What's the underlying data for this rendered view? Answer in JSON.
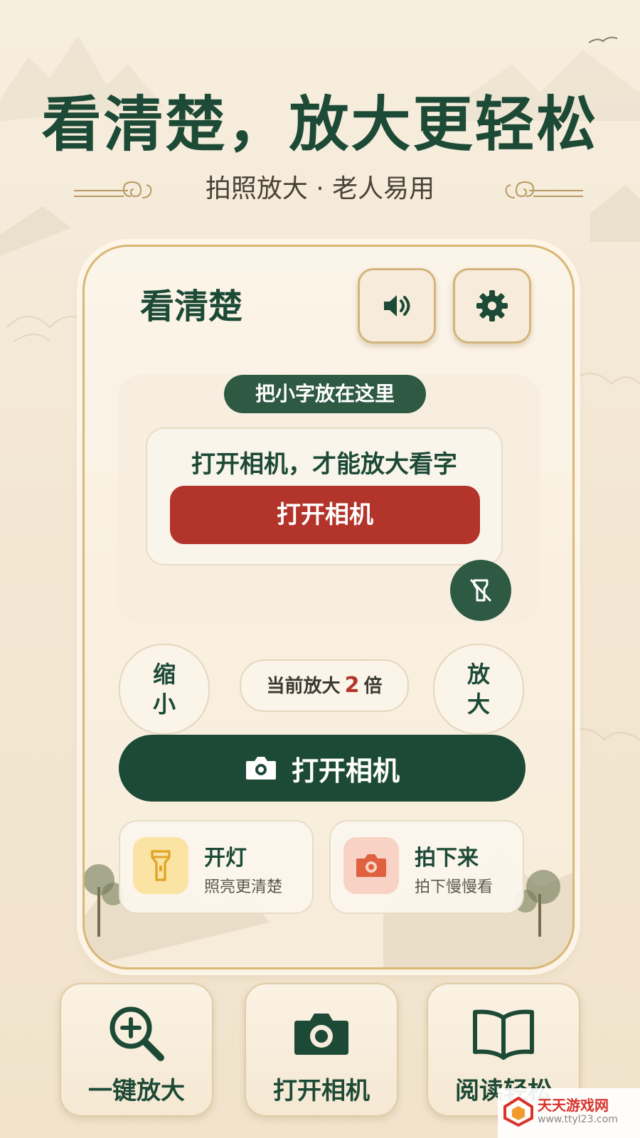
{
  "hero": {
    "title": "看清楚，放大更轻松",
    "subtitle": "拍照放大 · 老人易用"
  },
  "card": {
    "title": "看清楚",
    "sound_icon": "volume-icon",
    "settings_icon": "gear-icon",
    "preview": {
      "hint": "把小字放在这里",
      "message": "打开相机，才能放大看字",
      "open_camera_label": "打开相机",
      "flashlight_off_icon": "flashlight-off-icon"
    },
    "zoom": {
      "zoom_out_label": [
        "缩",
        "小"
      ],
      "zoom_in_label": [
        "放",
        "大"
      ],
      "status_prefix": "当前放大",
      "level": "2",
      "status_suffix": "倍"
    },
    "main_button": {
      "label": "打开相机",
      "icon": "camera-icon"
    },
    "features": [
      {
        "title": "开灯",
        "subtitle": "照亮更清楚",
        "icon": "flashlight-icon",
        "color": "#fbe3a4"
      },
      {
        "title": "拍下来",
        "subtitle": "拍下慢慢看",
        "icon": "camera-icon",
        "color": "#f7d2c5"
      }
    ]
  },
  "bottom_tiles": [
    {
      "label": "一键放大",
      "icon": "zoom-in-icon"
    },
    {
      "label": "打开相机",
      "icon": "camera-icon"
    },
    {
      "label": "阅读轻松",
      "icon": "book-icon"
    }
  ],
  "watermark": {
    "name": "天天游戏网",
    "url": "www.ttyl23.com"
  },
  "colors": {
    "primary_green": "#1d4a36",
    "accent_red": "#b3342a",
    "gold_border": "#d9b774",
    "background": "#f4e9d6"
  }
}
